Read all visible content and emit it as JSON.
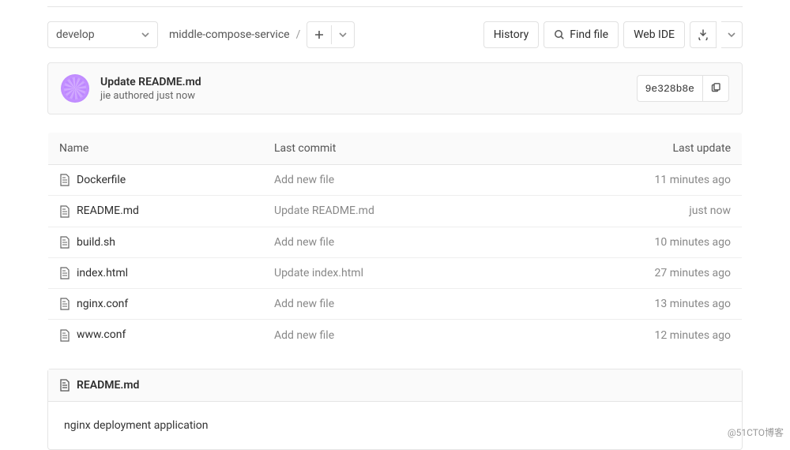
{
  "topbar": {
    "branch": "develop",
    "breadcrumb": "middle-compose-service",
    "history_label": "History",
    "find_file_label": "Find file",
    "web_ide_label": "Web IDE"
  },
  "commit": {
    "title": "Update README.md",
    "author": "jie",
    "action": "authored",
    "time": "just now",
    "sha": "9e328b8e"
  },
  "table": {
    "headers": {
      "name": "Name",
      "last_commit": "Last commit",
      "last_update": "Last update"
    },
    "rows": [
      {
        "name": "Dockerfile",
        "commit": "Add new file",
        "update": "11 minutes ago"
      },
      {
        "name": "README.md",
        "commit": "Update README.md",
        "update": "just now"
      },
      {
        "name": "build.sh",
        "commit": "Add new file",
        "update": "10 minutes ago"
      },
      {
        "name": "index.html",
        "commit": "Update index.html",
        "update": "27 minutes ago"
      },
      {
        "name": "nginx.conf",
        "commit": "Add new file",
        "update": "13 minutes ago"
      },
      {
        "name": "www.conf",
        "commit": "Add new file",
        "update": "12 minutes ago"
      }
    ]
  },
  "readme": {
    "title": "README.md",
    "content": "nginx deployment application"
  },
  "watermark": "@51CTO博客"
}
